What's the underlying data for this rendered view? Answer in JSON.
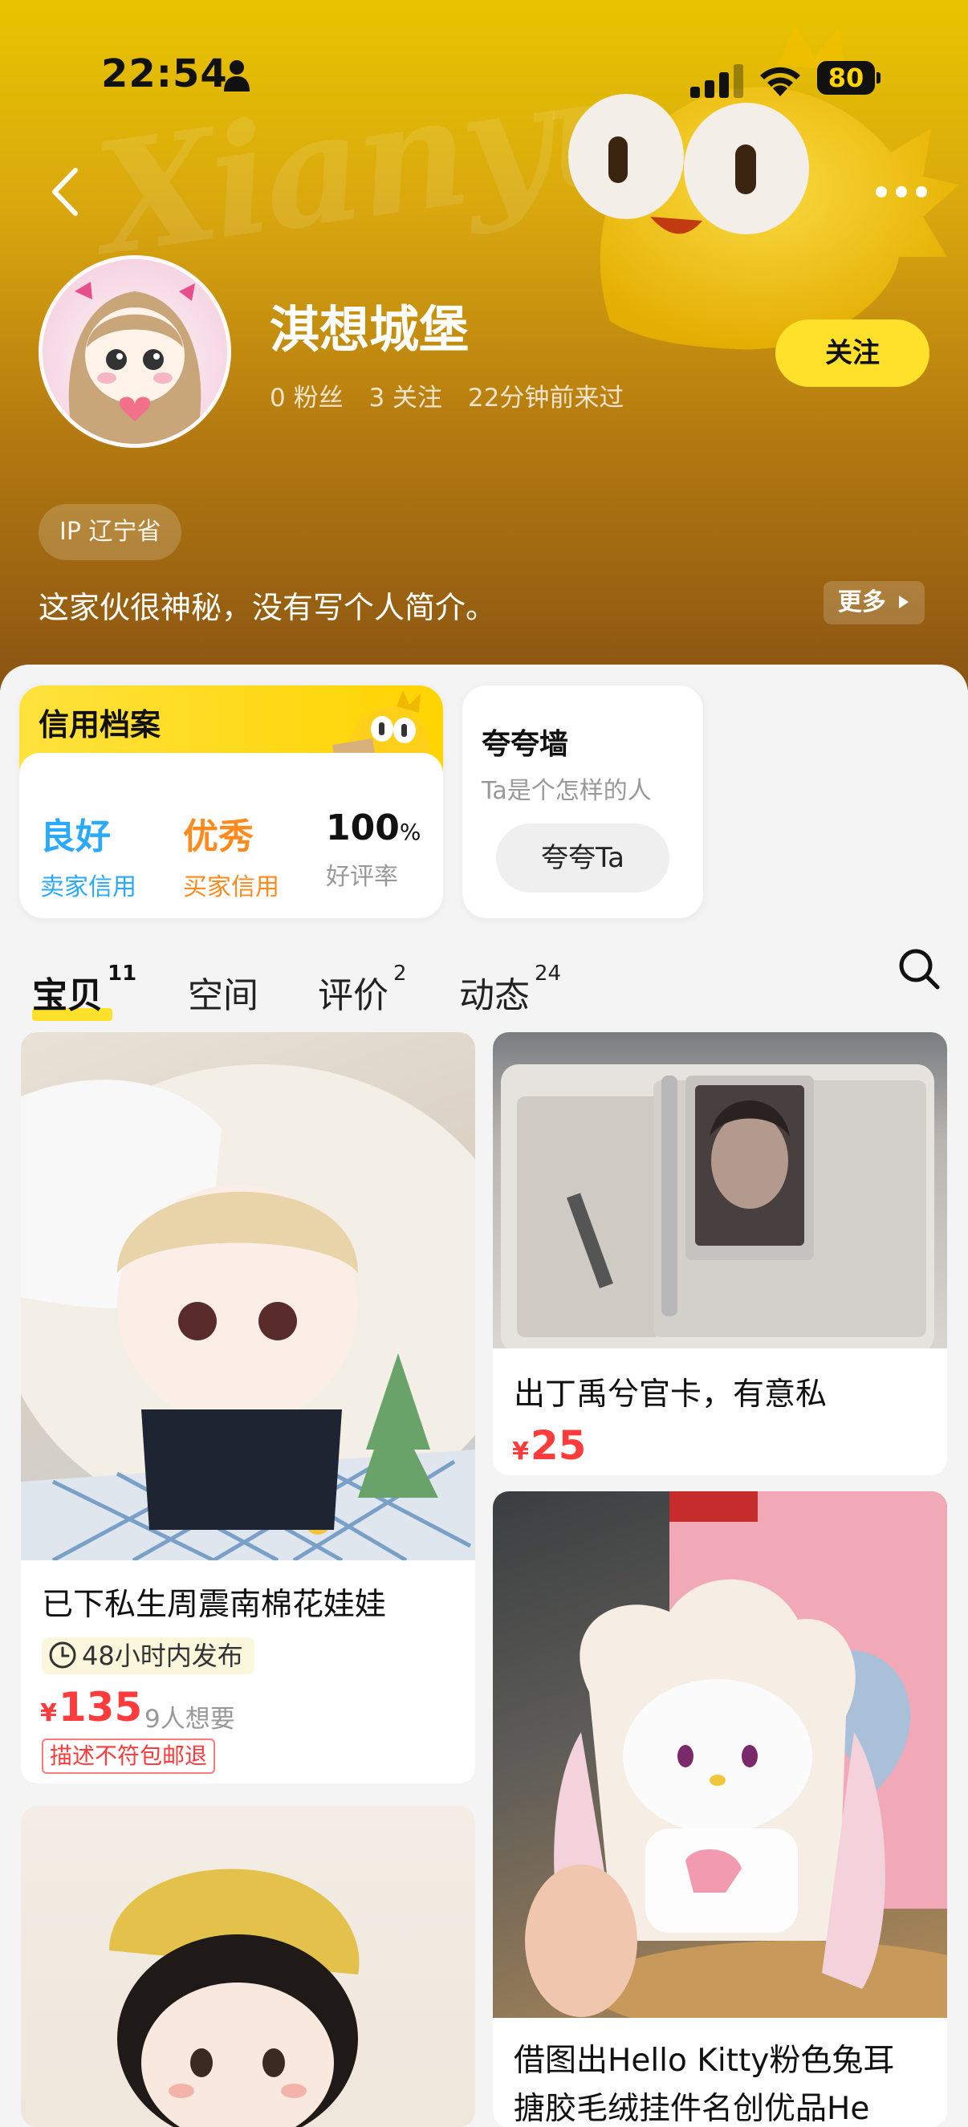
{
  "status_bar": {
    "time": "22:54",
    "battery": "80"
  },
  "profile": {
    "name": "淇想城堡",
    "fans": "0 粉丝",
    "following": "3 关注",
    "last_seen": "22分钟前来过",
    "follow_label": "关注",
    "ip_label": "IP 辽宁省",
    "bio": "这家伙很神秘，没有写个人简介。",
    "bio_more": "更多"
  },
  "credit": {
    "title": "信用档案",
    "stats": [
      {
        "value": "良好",
        "label": "卖家信用",
        "color": "#29a9ff"
      },
      {
        "value": "优秀",
        "label": "买家信用",
        "color": "#ff8a1e"
      },
      {
        "value": "100",
        "unit": "%",
        "label": "好评率",
        "color": "#111111"
      }
    ]
  },
  "praise": {
    "title": "夸夸墙",
    "subtitle": "Ta是个怎样的人",
    "button": "夸夸Ta"
  },
  "tabs": [
    {
      "label": "宝贝",
      "count": "11"
    },
    {
      "label": "空间",
      "count": ""
    },
    {
      "label": "评价",
      "count": "2"
    },
    {
      "label": "动态",
      "count": "24"
    }
  ],
  "products": [
    {
      "title": "已下私生周震南棉花娃娃",
      "time_tag": "48小时内发布",
      "price": "135",
      "want": "9人想要",
      "tag": "描述不符包邮退"
    },
    {
      "title": "出丁禹兮官卡，有意私",
      "price": "25"
    },
    {
      "title": "借图出Hello Kitty粉色兔耳",
      "title2": "搪胶毛绒挂件名创优品He"
    }
  ],
  "colors": {
    "accent": "#ffe02b",
    "price": "#ff3b3b"
  }
}
